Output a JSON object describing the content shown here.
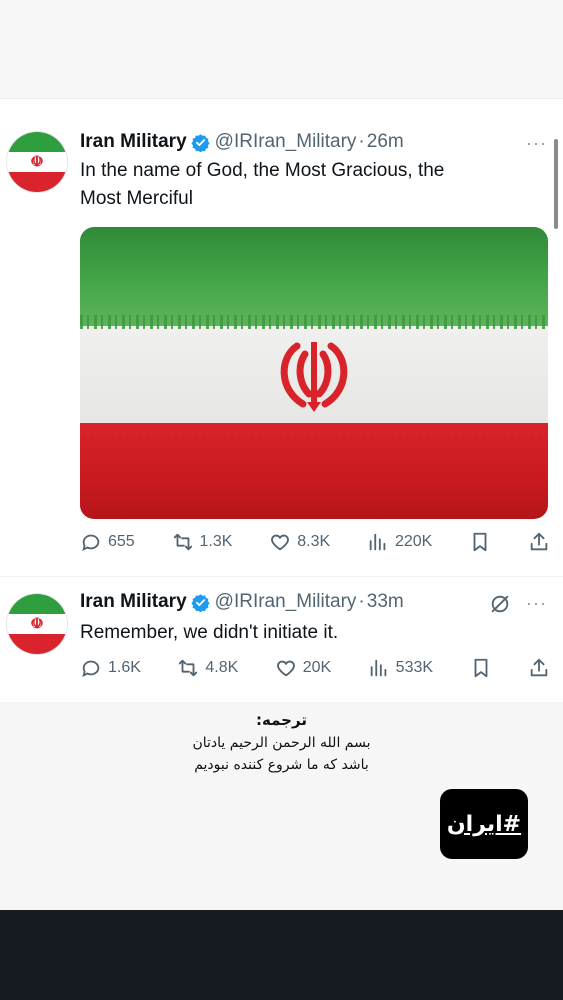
{
  "tweets": [
    {
      "name": "Iran Military",
      "handle": "@IRIran_Military",
      "separator": "·",
      "time": "26m",
      "more": "···",
      "text_line1": "In the name of God, the Most Gracious, the",
      "text_line2": "Most Merciful",
      "replies": "655",
      "retweets": "1.3K",
      "likes": "8.3K",
      "views": "220K"
    },
    {
      "name": "Iran Military",
      "handle": "@IRIran_Military",
      "separator": "·",
      "time": "33m",
      "more": "···",
      "text": "Remember, we didn't initiate it.",
      "replies": "1.6K",
      "retweets": "4.8K",
      "likes": "20K",
      "views": "533K"
    }
  ],
  "translation": {
    "heading": "ترجمه:",
    "line1": "بسم الله الرحمن الرحیم یادتان",
    "line2": "باشد که ما شروع کننده نبودیم"
  },
  "hashtag": "#ایران",
  "colors": {
    "verified": "#1d9bf0",
    "flag_green": "#2f9e3f",
    "flag_red": "#d9232d",
    "text_secondary": "#536471"
  },
  "icons": [
    "verified-icon",
    "more-icon",
    "grok-icon",
    "reply-icon",
    "retweet-icon",
    "like-icon",
    "views-icon",
    "bookmark-icon",
    "share-icon"
  ]
}
